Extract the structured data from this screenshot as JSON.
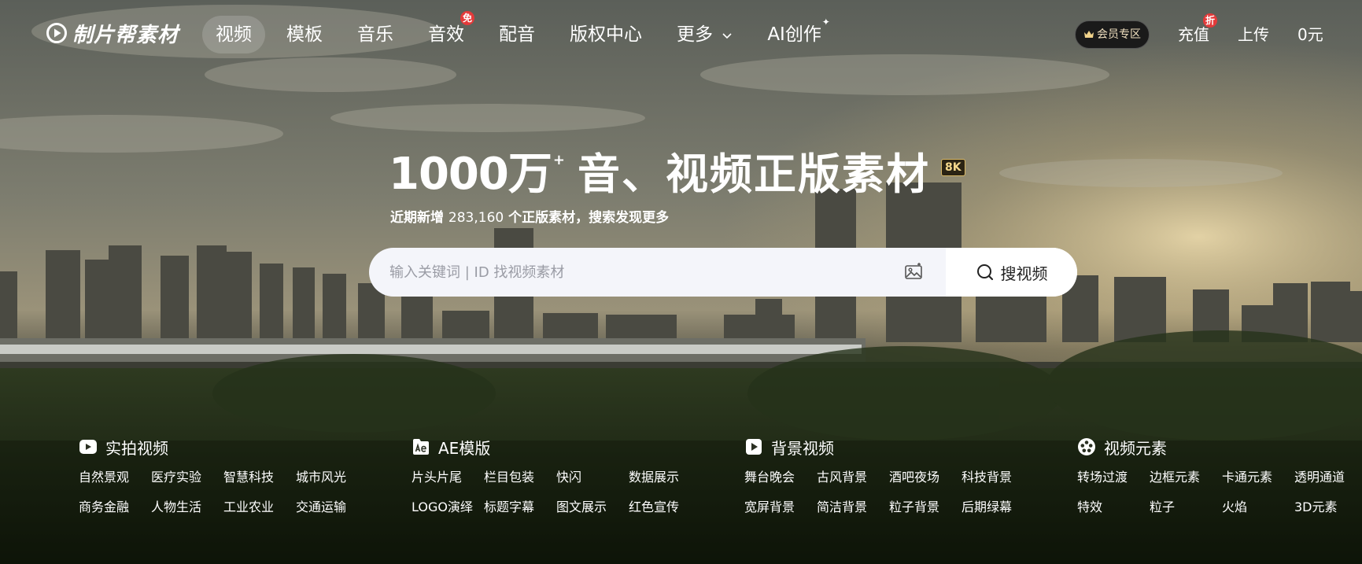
{
  "brand": {
    "name": "制片帮素材",
    "logo_icon": "play-circle-icon"
  },
  "nav": {
    "items": [
      {
        "label": "视频",
        "active": true
      },
      {
        "label": "模板"
      },
      {
        "label": "音乐"
      },
      {
        "label": "音效",
        "badge": "免"
      },
      {
        "label": "配音"
      },
      {
        "label": "版权中心"
      },
      {
        "label": "更多",
        "dropdown": true
      },
      {
        "label": "AI创作",
        "sparkle": "✦"
      }
    ]
  },
  "right_nav": {
    "vip": "会员专区",
    "recharge": "充值",
    "recharge_badge": "折",
    "upload": "上传",
    "balance": "0元"
  },
  "hero": {
    "title_count": "1000万",
    "title_plus": "+",
    "title_rest": "音、视频正版素材",
    "tag": "8K",
    "subtitle_prefix": "近期新增 ",
    "subtitle_number": "283,160",
    "subtitle_suffix": " 个正版素材，搜索发现更多"
  },
  "search": {
    "placeholder": "输入关键词 | ID 找视频素材",
    "value": "",
    "button_label": "搜视频"
  },
  "categories": [
    {
      "title": "实拍视频",
      "icon": "video-camera-icon",
      "links": [
        "自然景观",
        "医疗实验",
        "智慧科技",
        "城市风光",
        "商务金融",
        "人物生活",
        "工业农业",
        "交通运输"
      ]
    },
    {
      "title": "AE模版",
      "icon": "ae-file-icon",
      "links": [
        "片头片尾",
        "栏目包装",
        "快闪",
        "数据展示",
        "LOGO演绎",
        "标题字幕",
        "图文展示",
        "红色宣传"
      ]
    },
    {
      "title": "背景视频",
      "icon": "play-square-icon",
      "links": [
        "舞台晚会",
        "古风背景",
        "酒吧夜场",
        "科技背景",
        "宽屏背景",
        "简洁背景",
        "粒子背景",
        "后期绿幕"
      ]
    },
    {
      "title": "视频元素",
      "icon": "film-reel-icon",
      "links": [
        "转场过渡",
        "边框元素",
        "卡通元素",
        "透明通道",
        "特效",
        "粒子",
        "火焰",
        "3D元素"
      ]
    }
  ],
  "colors": {
    "badge_red": "#e43a3a",
    "search_bg": "#f4f5fa",
    "vip_text": "#f0e0c0",
    "tag_gold": "#f6d98c"
  }
}
